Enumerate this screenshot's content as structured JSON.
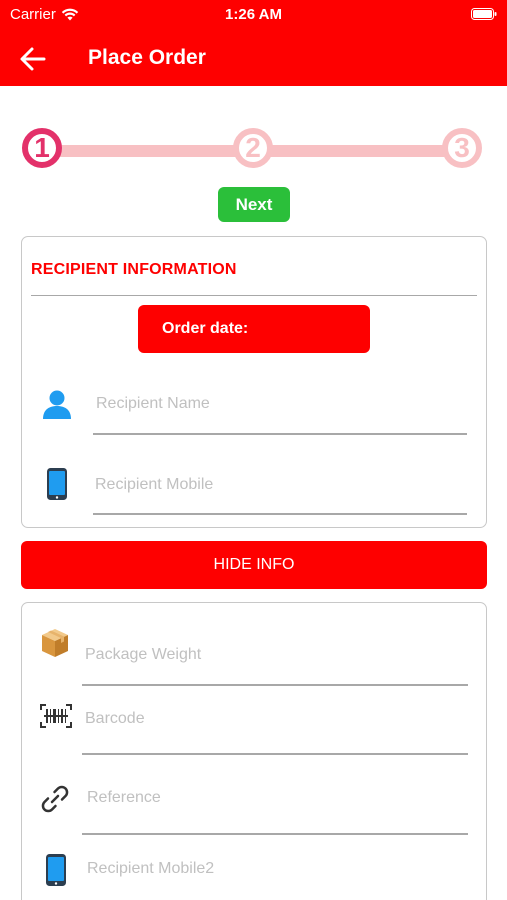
{
  "status_bar": {
    "carrier": "Carrier",
    "time": "1:26 AM"
  },
  "navbar": {
    "title": "Place Order"
  },
  "stepper": {
    "steps": [
      "1",
      "2",
      "3"
    ],
    "active_step": 1
  },
  "next_button": {
    "label": "Next"
  },
  "recipient_card": {
    "title": "RECIPIENT INFORMATION",
    "order_date_label": "Order date:",
    "fields": [
      {
        "placeholder": "Recipient Name",
        "icon": "person-icon"
      },
      {
        "placeholder": "Recipient Mobile",
        "icon": "mobile-phone-icon"
      }
    ]
  },
  "hide_info_button": {
    "label": "HIDE INFO"
  },
  "package_card": {
    "fields": [
      {
        "placeholder": "Package Weight",
        "icon": "package-icon"
      },
      {
        "placeholder": "Barcode",
        "icon": "barcode-scan-icon"
      },
      {
        "placeholder": "Reference",
        "icon": "link-icon"
      },
      {
        "placeholder": "Recipient Mobile2",
        "icon": "mobile-phone-icon"
      }
    ]
  },
  "colors": {
    "primary_red": "#fe0000",
    "next_green": "#2bbf3a",
    "step_active": "#e3316a",
    "step_inactive": "#f8c0c3"
  }
}
